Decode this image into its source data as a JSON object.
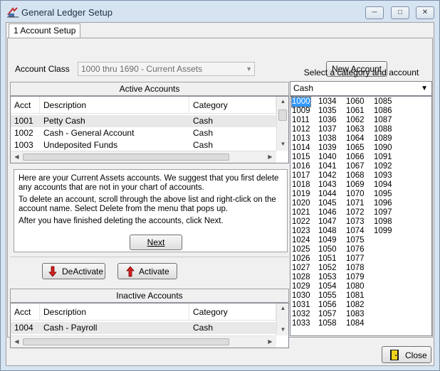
{
  "window": {
    "title": "General Ledger Setup"
  },
  "tabs": [
    {
      "label": "1 Account Setup"
    }
  ],
  "account_class": {
    "label": "Account Class",
    "selected": "1000 thru 1690 - Current Assets"
  },
  "buttons": {
    "new_account": "New Account",
    "next": "Next",
    "deactivate": "DeActivate",
    "activate": "Activate",
    "close": "Close"
  },
  "active_accounts": {
    "title": "Active Accounts",
    "columns": [
      "Acct",
      "Description",
      "Category"
    ],
    "rows": [
      {
        "acct": "1001",
        "description": "Petty Cash",
        "category": "Cash"
      },
      {
        "acct": "1002",
        "description": "Cash - General Account",
        "category": "Cash"
      },
      {
        "acct": "1003",
        "description": "Undeposited Funds",
        "category": "Cash"
      }
    ]
  },
  "instructions": {
    "p1": "Here are your Current Assets accounts. We suggest that you first delete any accounts that are not in your chart of accounts.",
    "p2": "To delete an account, scroll through the above list and right-click on the account name.  Select Delete from the menu that pops up.",
    "p3": "After you have finished deleting the accounts, click Next."
  },
  "inactive_accounts": {
    "title": "Inactive Accounts",
    "columns": [
      "Acct",
      "Description",
      "Category"
    ],
    "rows": [
      {
        "acct": "1004",
        "description": "Cash - Payroll",
        "category": "Cash"
      }
    ]
  },
  "category_panel": {
    "title": "Select a category and account",
    "selected_category": "Cash",
    "selected_code": "1000",
    "codes": [
      [
        "1000",
        "1009",
        "1011",
        "1012",
        "1013",
        "1014",
        "1015",
        "1016",
        "1017",
        "1018",
        "1019",
        "1020",
        "1021",
        "1022",
        "1023",
        "1024",
        "1025",
        "1026",
        "1027",
        "1028",
        "1029",
        "1030",
        "1031",
        "1032",
        "1033"
      ],
      [
        "1034",
        "1035",
        "1036",
        "1037",
        "1038",
        "1039",
        "1040",
        "1041",
        "1042",
        "1043",
        "1044",
        "1045",
        "1046",
        "1047",
        "1048",
        "1049",
        "1050",
        "1051",
        "1052",
        "1053",
        "1054",
        "1055",
        "1056",
        "1057",
        "1058"
      ],
      [
        "1060",
        "1061",
        "1062",
        "1063",
        "1064",
        "1065",
        "1066",
        "1067",
        "1068",
        "1069",
        "1070",
        "1071",
        "1072",
        "1073",
        "1074",
        "1075",
        "1076",
        "1077",
        "1078",
        "1079",
        "1080",
        "1081",
        "1082",
        "1083",
        "1084"
      ],
      [
        "1085",
        "1086",
        "1087",
        "1088",
        "1089",
        "1090",
        "1091",
        "1092",
        "1093",
        "1094",
        "1095",
        "1096",
        "1097",
        "1098",
        "1099"
      ]
    ]
  }
}
